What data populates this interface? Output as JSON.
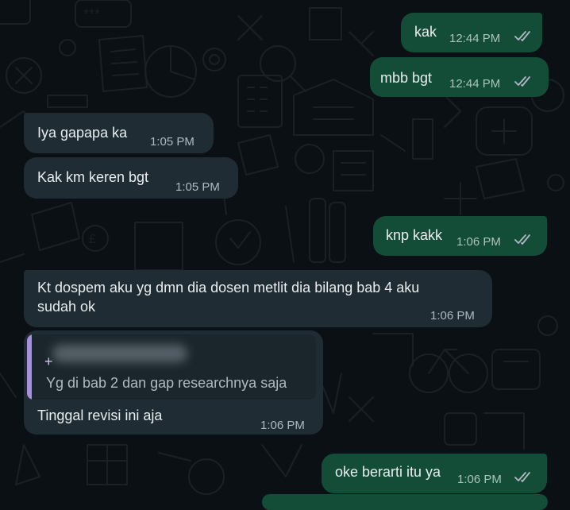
{
  "colors": {
    "background": "#0b1014",
    "outgoing_bubble": "#144d37",
    "incoming_bubble": "#202c33",
    "quote_accent": "#a78fe0",
    "read_ticks": "#aebac1"
  },
  "messages": [
    {
      "direction": "outgoing",
      "text": "kak",
      "time": "12:44 PM",
      "status": "read-double-tick-icon"
    },
    {
      "direction": "outgoing",
      "text": "mbb bgt",
      "time": "12:44 PM",
      "status": "read-double-tick-icon"
    },
    {
      "direction": "incoming",
      "text": "Iya gapapa ka",
      "time": "1:05 PM"
    },
    {
      "direction": "incoming",
      "text": "Kak km keren bgt",
      "time": "1:05 PM"
    },
    {
      "direction": "outgoing",
      "text": "knp kakk",
      "time": "1:06 PM",
      "status": "read-double-tick-icon"
    },
    {
      "direction": "incoming",
      "text": "Kt dospem aku yg dmn dia dosen metlit dia bilang bab 4 aku",
      "text_line2": "sudah ok",
      "time": "1:06 PM"
    },
    {
      "direction": "incoming",
      "quote": {
        "author_prefix": "+",
        "text": "Yg di bab 2 dan gap researchnya saja"
      },
      "text": "Tinggal revisi ini aja",
      "time": "1:06 PM"
    },
    {
      "direction": "outgoing",
      "text": "oke berarti itu ya",
      "time": "1:06 PM",
      "status": "read-double-tick-icon"
    }
  ]
}
